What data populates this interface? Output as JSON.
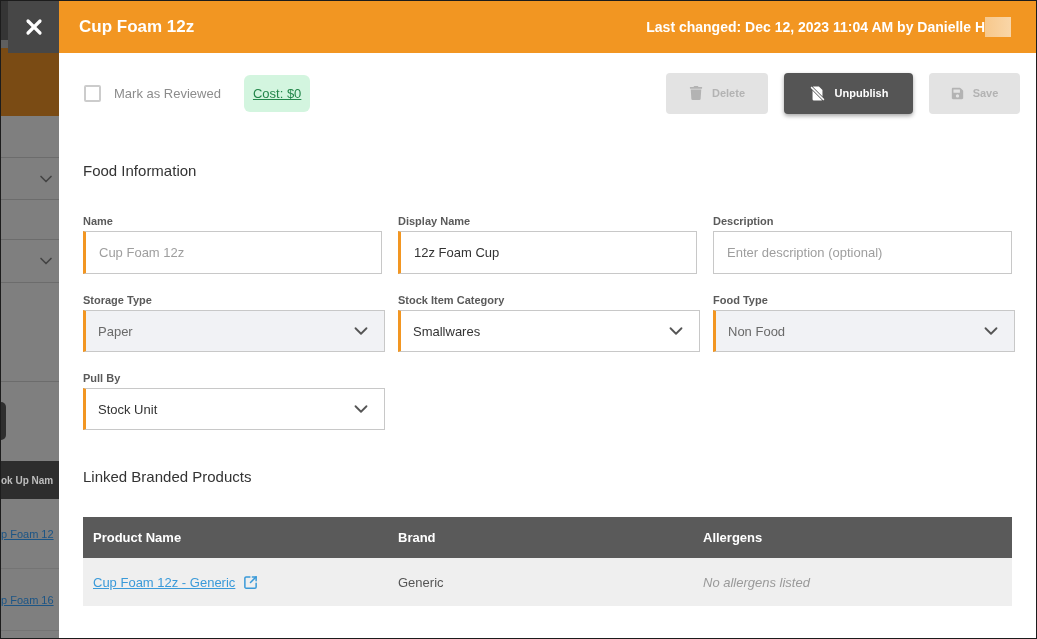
{
  "backdrop": {
    "column_header": "ok Up Nam",
    "links": [
      "p Foam 12",
      "p Foam 16"
    ]
  },
  "drawer": {
    "title": "Cup Foam 12z",
    "last_changed": "Last changed: Dec 12, 2023 11:04 AM by Danielle H",
    "toolbar": {
      "mark_as_reviewed": {
        "label": "Mark as Reviewed",
        "checked": false
      },
      "cost": "Cost: $0",
      "buttons": [
        {
          "label": "Delete",
          "kind": "delete",
          "disabled": true
        },
        {
          "label": "Unpublish",
          "kind": "unpublish",
          "disabled": false
        },
        {
          "label": "Save",
          "kind": "save",
          "disabled": true
        }
      ]
    },
    "food_information": {
      "heading": "Food Information",
      "fields": [
        {
          "label": "Name",
          "kind": "input",
          "placeholder": "Cup Foam 12z",
          "required": true,
          "disabled": false
        },
        {
          "label": "Display Name",
          "kind": "input",
          "value": "12z Foam Cup",
          "required": true,
          "disabled": false
        },
        {
          "label": "Description",
          "kind": "input",
          "placeholder": "Enter description (optional)",
          "required": false,
          "disabled": false
        },
        {
          "label": "Storage Type",
          "kind": "select",
          "value": "Paper",
          "required": true,
          "disabled": true
        },
        {
          "label": "Stock Item Category",
          "kind": "select",
          "value": "Smallwares",
          "required": true,
          "disabled": false
        },
        {
          "label": "Food Type",
          "kind": "select",
          "value": "Non Food",
          "required": true,
          "disabled": true
        },
        {
          "label": "Pull By",
          "kind": "select",
          "value": "Stock Unit",
          "required": true,
          "disabled": false
        }
      ]
    },
    "linked_products": {
      "heading": "Linked Branded Products",
      "table": {
        "columns": [
          "Product Name",
          "Brand",
          "Allergens"
        ],
        "rows": [
          {
            "product_name": "Cup Foam 12z - Generic",
            "brand": "Generic",
            "allergens": "No allergens listed"
          }
        ]
      }
    }
  }
}
